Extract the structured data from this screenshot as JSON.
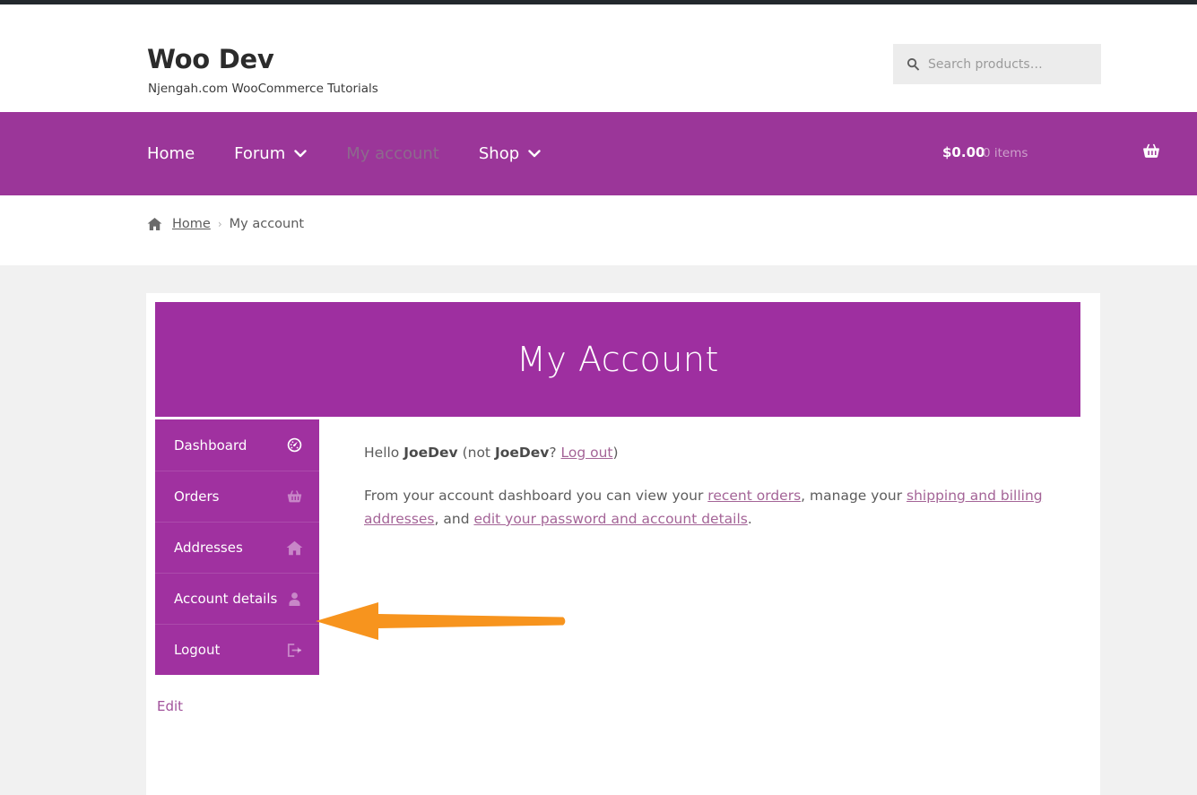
{
  "header": {
    "site_title": "Woo Dev",
    "tagline": "Njengah.com WooCommerce Tutorials",
    "search": {
      "placeholder": "Search products…",
      "value": "",
      "icon": "search-icon"
    }
  },
  "nav": {
    "items": [
      {
        "label": "Home",
        "has_caret": false,
        "state": "normal"
      },
      {
        "label": "Forum",
        "has_caret": true,
        "state": "normal"
      },
      {
        "label": "My account",
        "has_caret": false,
        "state": "current"
      },
      {
        "label": "Shop",
        "has_caret": true,
        "state": "normal"
      }
    ],
    "caret_glyph": "❯",
    "cart": {
      "total": "$0.00",
      "count": "0 items",
      "icon": "shopping-basket-icon"
    },
    "background_color": "#9b3699"
  },
  "breadcrumb": {
    "home_icon": "home-icon",
    "home_label": "Home",
    "separator": "›",
    "current": "My account"
  },
  "account": {
    "banner_title": "My Account",
    "banner_color": "#9e2fa0",
    "menu": [
      {
        "label": "Dashboard",
        "icon": "dashboard-gauge-icon",
        "active": true
      },
      {
        "label": "Orders",
        "icon": "shopping-basket-icon",
        "active": false
      },
      {
        "label": "Addresses",
        "icon": "home-icon",
        "active": false
      },
      {
        "label": "Account details",
        "icon": "user-person-icon",
        "active": false
      },
      {
        "label": "Logout",
        "icon": "logout-arrow-icon",
        "active": false
      }
    ],
    "menu_color": "#a031a0",
    "greeting": {
      "hello_prefix": "Hello ",
      "username": "JoeDev",
      "not_prefix": " (not ",
      "not_username": "JoeDev",
      "question": "? ",
      "logout_link": "Log out",
      "suffix": ")"
    },
    "dashboard_text": {
      "part1": "From your account dashboard you can view your ",
      "link1": "recent orders",
      "part2": ", manage your ",
      "link2": "shipping and billing addresses",
      "part3": ", and ",
      "link3": "edit your password and account details",
      "part4": "."
    },
    "edit_link": "Edit"
  },
  "annotation": {
    "type": "arrow",
    "color": "#f7941e",
    "direction": "left",
    "points_at": "Logout menu item"
  }
}
